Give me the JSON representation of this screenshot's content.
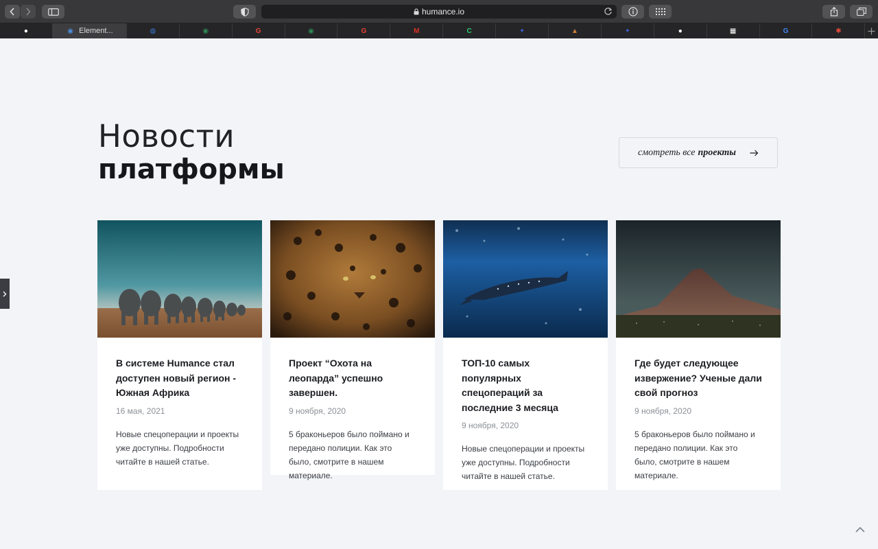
{
  "browser": {
    "url": "humance.io",
    "active_tab_label": "Element...",
    "tabs": [
      {
        "icon": "panda-icon",
        "color": "#ffffff",
        "glyph": "●"
      },
      {
        "icon": "globe-icon",
        "color": "#4a90d9",
        "glyph": "◉",
        "active": true
      },
      {
        "icon": "earth-icon",
        "color": "#3a7bd5",
        "glyph": "◍"
      },
      {
        "icon": "globe-icon",
        "color": "#2e8b57",
        "glyph": "◉"
      },
      {
        "icon": "google-icon",
        "color": "#ea4335",
        "glyph": "G"
      },
      {
        "icon": "globe-icon",
        "color": "#2e8b57",
        "glyph": "◉"
      },
      {
        "icon": "google-icon",
        "color": "#ea4335",
        "glyph": "G"
      },
      {
        "icon": "gmail-icon",
        "color": "#d93025",
        "glyph": "M"
      },
      {
        "icon": "crescent-icon",
        "color": "#2ecc71",
        "glyph": "C"
      },
      {
        "icon": "astronaut-icon",
        "color": "#3a5cc8",
        "glyph": "✦"
      },
      {
        "icon": "mountain-icon",
        "color": "#d0803a",
        "glyph": "▲"
      },
      {
        "icon": "astronaut-icon",
        "color": "#3a5cc8",
        "glyph": "✦"
      },
      {
        "icon": "panda-icon",
        "color": "#ffffff",
        "glyph": "●"
      },
      {
        "icon": "pixel-icon",
        "color": "#ffffff",
        "glyph": "▦"
      },
      {
        "icon": "google-icon",
        "color": "#4285f4",
        "glyph": "G"
      },
      {
        "icon": "asterisk-icon",
        "color": "#e74c3c",
        "glyph": "✱"
      }
    ]
  },
  "section": {
    "title_light": "Новости",
    "title_bold": "платформы",
    "all_button": {
      "prefix": "смотреть все",
      "bold": "проекты"
    }
  },
  "cards": [
    {
      "image": "elephants",
      "title": "В системе Humance стал доступен новый регион - Южная Африка",
      "date": "16 мая, 2021",
      "desc": "Новые спецоперации и проекты уже доступны. Подробности читайте в нашей статье."
    },
    {
      "image": "leopard",
      "title": "Проект “Охота на леопарда” успешно завершен.",
      "date": "9 ноября, 2020",
      "desc": "5 браконьеров было поймано и передано полиции. Как это было, смотрите в нашем материале."
    },
    {
      "image": "whale-shark",
      "title": "ТОП-10 самых популярных спецопераций за последние 3 месяца",
      "date": "9 ноября, 2020",
      "desc": "Новые спецоперации и проекты уже доступны. Подробности читайте в нашей статье."
    },
    {
      "image": "volcano",
      "title": "Где будет следующее извержение? Ученые дали свой прогноз",
      "date": "9 ноября, 2020",
      "desc": "5 браконьеров было поймано и передано полиции. Как это было, смотрите в нашем материале."
    }
  ]
}
